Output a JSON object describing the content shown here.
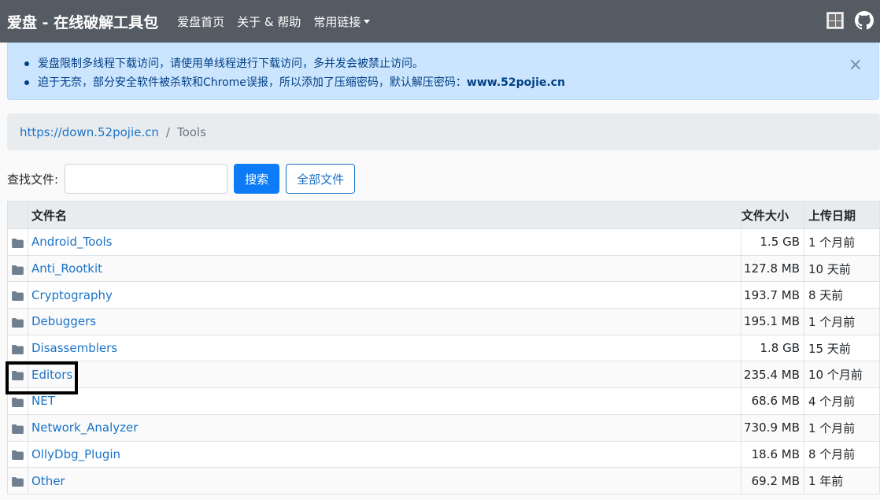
{
  "navbar": {
    "brand": "爱盘 - 在线破解工具包",
    "links": [
      "爱盘首页",
      "关于 & 帮助",
      "常用链接"
    ],
    "icons": [
      "qr-code-icon",
      "github-icon"
    ]
  },
  "alert": {
    "line1": "爱盘限制多线程下载访问，请使用单线程进行下载访问，多并发会被禁止访问。",
    "line2_prefix": "迫于无奈，部分安全软件被杀软和Chrome误报，所以添加了压缩密码，默认解压密码：",
    "line2_password": "www.52pojie.cn",
    "close": "×"
  },
  "breadcrumb": {
    "root": "https://down.52pojie.cn",
    "separator": "/",
    "current": "Tools"
  },
  "search": {
    "label": "查找文件:",
    "value": "",
    "search_button": "搜索",
    "all_files_button": "全部文件"
  },
  "table": {
    "headers": {
      "name": "文件名",
      "size": "文件大小",
      "date": "上传日期"
    },
    "rows": [
      {
        "name": "Android_Tools",
        "size": "1.5 GB",
        "date": "1 个月前"
      },
      {
        "name": "Anti_Rootkit",
        "size": "127.8 MB",
        "date": "10 天前"
      },
      {
        "name": "Cryptography",
        "size": "193.7 MB",
        "date": "8 天前"
      },
      {
        "name": "Debuggers",
        "size": "195.1 MB",
        "date": "1 个月前"
      },
      {
        "name": "Disassemblers",
        "size": "1.8 GB",
        "date": "15 天前"
      },
      {
        "name": "Editors",
        "size": "235.4 MB",
        "date": "10 个月前"
      },
      {
        "name": "NET",
        "size": "68.6 MB",
        "date": "4 个月前"
      },
      {
        "name": "Network_Analyzer",
        "size": "730.9 MB",
        "date": "1 个月前"
      },
      {
        "name": "OllyDbg_Plugin",
        "size": "18.6 MB",
        "date": "8 个月前"
      },
      {
        "name": "Other",
        "size": "69.2 MB",
        "date": "1 年前"
      }
    ],
    "highlighted_row": "Editors"
  },
  "colors": {
    "navbar": "#555b63",
    "link": "#1a73c8",
    "primary": "#0d7bf5",
    "alert_bg": "#cce5ff",
    "alert_text": "#004085"
  }
}
